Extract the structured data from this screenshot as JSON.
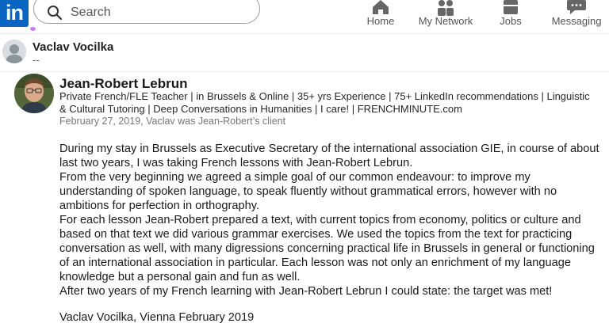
{
  "nav": {
    "logo_text": "in",
    "search_placeholder": "Search",
    "items": [
      {
        "label": "Home",
        "icon": "home-icon"
      },
      {
        "label": "My Network",
        "icon": "people-icon"
      },
      {
        "label": "Jobs",
        "icon": "briefcase-icon"
      },
      {
        "label": "Messaging",
        "icon": "chat-icon"
      }
    ]
  },
  "author": {
    "name": "Vaclav Vocilka",
    "subtitle": "--"
  },
  "recommendation": {
    "name": "Jean-Robert Lebrun",
    "headline": "Private French/FLE Teacher | in Brussels & Online | 35+ yrs Experience | 75+ LinkedIn recommendations | Linguistic & Cultural Tutoring | Deep Conversations in Humanities | I care! | FRENCHMINUTE.com",
    "date": "February 27, 2019, Vaclav was Jean-Robert’s client",
    "paragraphs": [
      "During my stay in Brussels as Executive Secretary of the international association GIE, in course of about last two years, I was taking French lessons with Jean-Robert Lebrun.",
      "From the very beginning we agreed a simple goal of our common endeavour: to improve my understanding of spoken language, to speak fluently without grammatical errors, however with no ambitions for perfection in orthography.",
      "For each lesson Jean-Robert prepared a text, with current topics from economy, politics or culture and based on that text we did various grammar exercises. We used the topics from the text for practicing conversation as well, with many digressions concerning practical life in Brussels in general or functioning of an international association in particular. Each lesson was not only an enrichment of my language knowledge but a personal gain and fun as well.",
      "After two years of my French learning with Jean-Robert Lebrun I could state: the target was met!"
    ],
    "signature": "Vaclav Vocilka, Vienna February 2019"
  },
  "colors": {
    "brand": "#0a66c2",
    "nav_text": "#555555",
    "muted": "#777777"
  }
}
